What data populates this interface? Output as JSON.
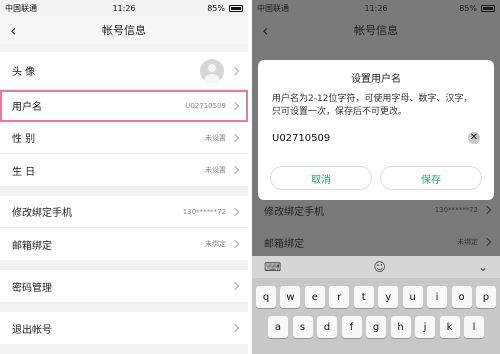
{
  "left": {
    "status": {
      "carrier": "中国联通",
      "time": "11:26",
      "battery": "85%"
    },
    "nav": {
      "title": "帐号信息"
    },
    "groups": [
      [
        {
          "label": "头 像",
          "value": ""
        },
        {
          "label": "用户名",
          "value": "U02710509"
        },
        {
          "label": "性 别",
          "value": "未设置"
        },
        {
          "label": "生 日",
          "value": "未设置"
        }
      ],
      [
        {
          "label": "修改绑定手机",
          "value": "130******72"
        },
        {
          "label": "邮箱绑定",
          "value": "未绑定"
        }
      ],
      [
        {
          "label": "密码管理",
          "value": ""
        }
      ],
      [
        {
          "label": "退出帐号",
          "value": ""
        }
      ]
    ]
  },
  "right": {
    "status": {
      "carrier": "中国联通",
      "time": "11:26",
      "battery": "85%"
    },
    "nav": {
      "title": "帐号信息"
    },
    "dialog": {
      "title": "设置用户名",
      "message": "用户名为2-12位字符，可使用字母、数字、汉字，只可设置一次，保存后不可更改。",
      "input_value": "U02710509",
      "cancel": "取消",
      "save": "保存"
    },
    "behind_rows": [
      {
        "label": "修改绑定手机",
        "value": "130******72"
      },
      {
        "label": "邮箱绑定",
        "value": "未绑定"
      }
    ],
    "keyboard": {
      "row1": [
        "q",
        "w",
        "e",
        "r",
        "t",
        "y",
        "u",
        "i",
        "o",
        "p"
      ],
      "row2": [
        "a",
        "s",
        "d",
        "f",
        "g",
        "h",
        "j",
        "k",
        "l"
      ]
    }
  }
}
